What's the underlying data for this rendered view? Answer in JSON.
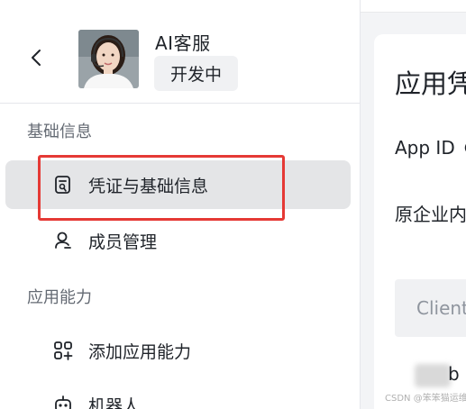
{
  "header": {
    "app_name": "AI客服",
    "status": "开发中"
  },
  "sidebar": {
    "sections": [
      {
        "title": "基础信息",
        "items": [
          {
            "label": "凭证与基础信息",
            "icon": "credential-icon",
            "active": true
          },
          {
            "label": "成员管理",
            "icon": "member-icon",
            "active": false
          }
        ]
      },
      {
        "title": "应用能力",
        "items": [
          {
            "label": "添加应用能力",
            "icon": "add-capability-icon",
            "active": false
          },
          {
            "label": "机器人",
            "icon": "robot-icon",
            "active": false
          }
        ]
      }
    ]
  },
  "main": {
    "title": "应用凭",
    "fields": {
      "app_id_label": "App ID",
      "enterprise_label": "原企业内",
      "client_label": "Client"
    },
    "partial_text": "b"
  },
  "watermark": "CSDN @笨笨猫运维",
  "colors": {
    "active_bg": "#e4e5e7",
    "highlight_border": "#e53935",
    "muted_text": "#646a73"
  }
}
